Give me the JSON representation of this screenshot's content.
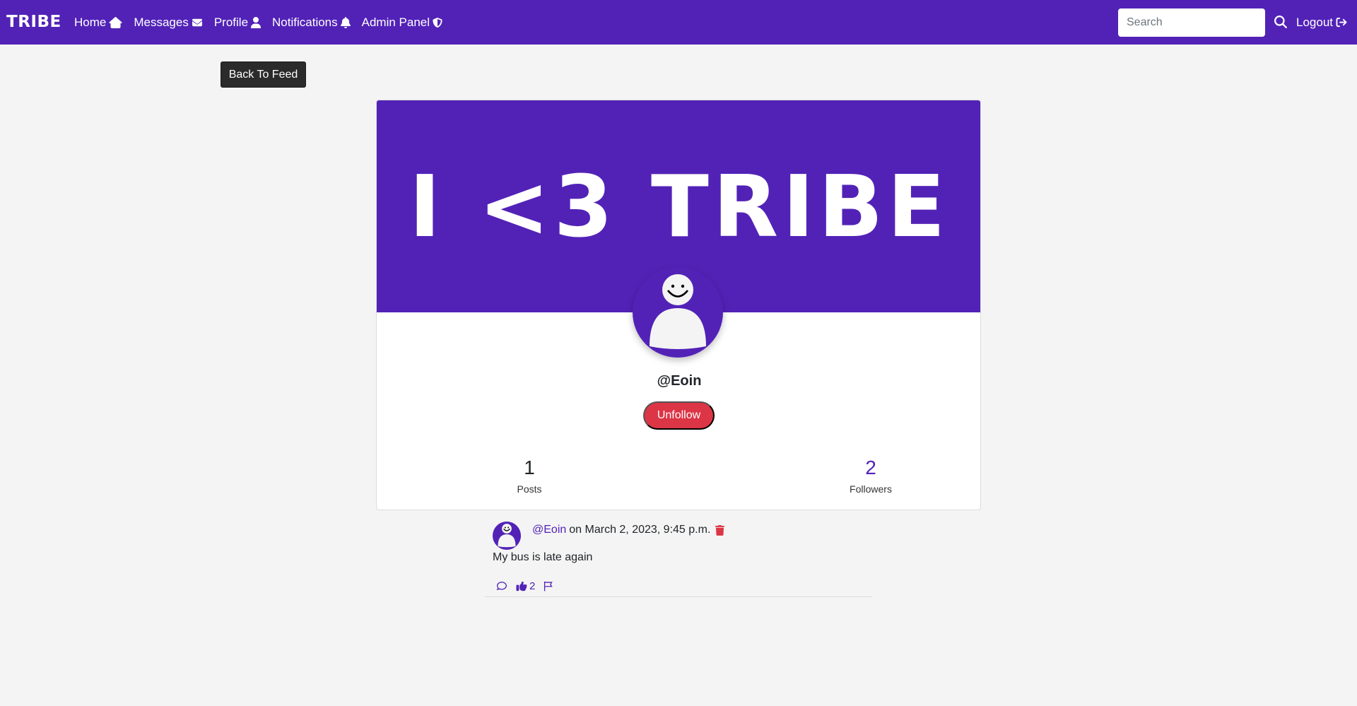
{
  "nav": {
    "brand": "TRIBE",
    "links": [
      {
        "label": "Home",
        "icon": "home-icon"
      },
      {
        "label": "Messages",
        "icon": "envelope-icon"
      },
      {
        "label": "Profile",
        "icon": "user-icon"
      },
      {
        "label": "Notifications",
        "icon": "bell-icon"
      },
      {
        "label": "Admin Panel",
        "icon": "shield-icon"
      }
    ],
    "search_placeholder": "Search",
    "logout_label": "Logout"
  },
  "back_button": "Back To Feed",
  "profile": {
    "banner_text": "I <3 TRIBE",
    "username": "@Eoin",
    "unfollow_label": "Unfollow",
    "posts_count": "1",
    "posts_label": "Posts",
    "followers_count": "2",
    "followers_label": "Followers"
  },
  "post": {
    "author": "@Eoin",
    "timestamp": "on March 2, 2023, 9:45 p.m.",
    "body": "My bus is late again",
    "likes": "2"
  },
  "colors": {
    "brand": "#5222b7",
    "danger": "#dc3545",
    "page_bg": "#f4f4f4"
  }
}
